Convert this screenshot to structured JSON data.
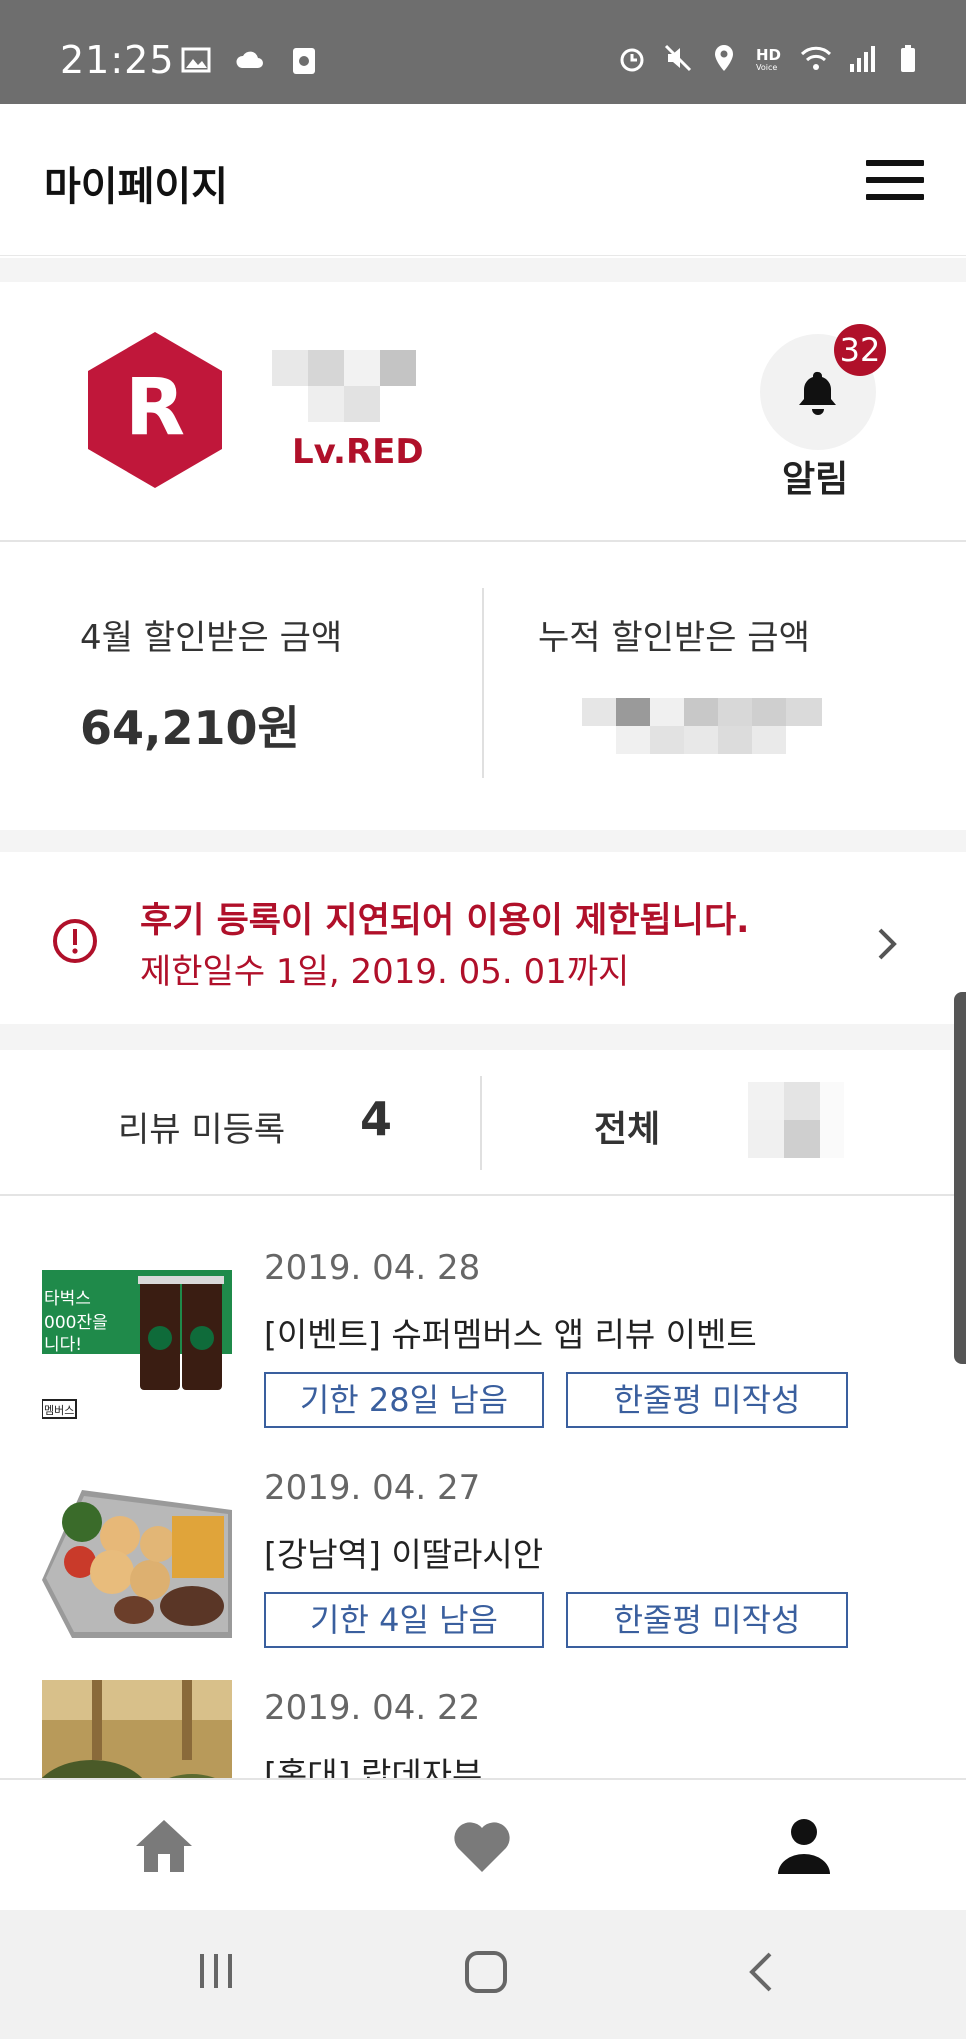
{
  "status_bar": {
    "time": "21:25"
  },
  "header": {
    "title": "마이페이지"
  },
  "profile": {
    "logo_letter": "R",
    "level": "Lv.RED",
    "notification_count": "32",
    "notification_label": "알림"
  },
  "amounts": {
    "monthly_label": "4월 할인받은 금액",
    "monthly_value": "64,210원",
    "total_label": "누적 할인받은 금액"
  },
  "warning": {
    "title": "후기 등록이 지연되어 이용이 제한됩니다.",
    "subtitle": "제한일수 1일, 2019. 05. 01까지"
  },
  "review_tabs": {
    "unregistered_label": "리뷰 미등록",
    "unregistered_count": "4",
    "all_label": "전체"
  },
  "reviews": [
    {
      "date": "2019. 04. 28",
      "title": "[이벤트] 슈퍼멤버스 앱 리뷰 이벤트",
      "deadline": "기한 28일 남음",
      "status": "한줄평 미작성",
      "thumb_text_1": "타벅스",
      "thumb_text_2": "000잔을",
      "thumb_text_3": "니다!",
      "thumb_text_4": "멤버스"
    },
    {
      "date": "2019. 04. 27",
      "title": "[강남역] 이딸라시안",
      "deadline": "기한 4일 남음",
      "status": "한줄평 미작성"
    },
    {
      "date": "2019. 04. 22",
      "title": "[홍대] 랍데자뷰"
    }
  ],
  "colors": {
    "brand_red": "#b0102a",
    "pill_blue": "#3a5f9e"
  },
  "bottom_nav": {
    "items": [
      "home-icon",
      "heart-icon",
      "person-icon"
    ]
  }
}
